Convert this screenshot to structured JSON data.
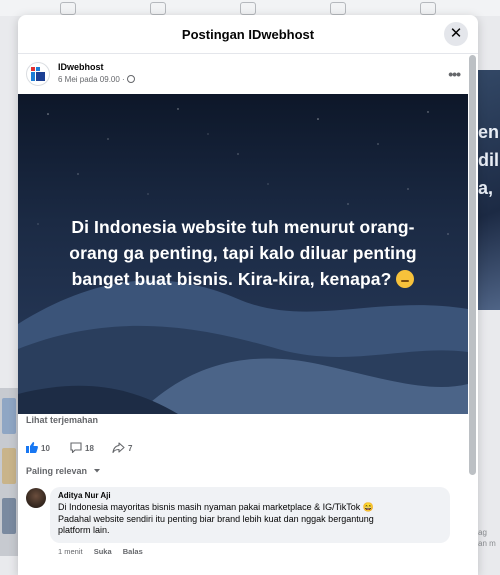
{
  "modal": {
    "title": "Postingan IDwebhost",
    "close_label": "✕"
  },
  "post": {
    "page_name": "IDwebhost",
    "meta": "6 Mei pada 09.00 ·",
    "more_label": "•••",
    "image_text_lines": [
      "Di Indonesia website tuh menurut orang-",
      "orang ga penting, tapi kalo diluar penting",
      "banget buat bisnis. Kira-kira, kenapa?"
    ],
    "translate_link": "Lihat terjemahan",
    "like_count": "10",
    "comment_count": "18",
    "share_count": "7",
    "sort_label": "Paling relevan"
  },
  "comment": {
    "author": "Aditya Nur Aji",
    "text_lines": [
      "Di Indonesia mayoritas bisnis masih nyaman pakai marketplace & IG/TikTok 😄",
      "Padahal website sendiri itu penting biar brand lebih kuat dan nggak bergantung",
      "platform lain."
    ],
    "time": "1 menit",
    "like_label": "Suka",
    "reply_label": "Balas"
  },
  "background": {
    "right_text": [
      "en",
      "dil",
      "a,"
    ],
    "side_text": [
      "ag",
      "an m"
    ]
  },
  "colors": {
    "accent": "#1877f2",
    "secondary_text": "#65676b",
    "bubble": "#f0f2f5"
  },
  "icons": [
    "close-icon",
    "globe-icon",
    "like-icon",
    "comment-icon",
    "share-icon",
    "chevron-down-icon",
    "more-icon"
  ]
}
